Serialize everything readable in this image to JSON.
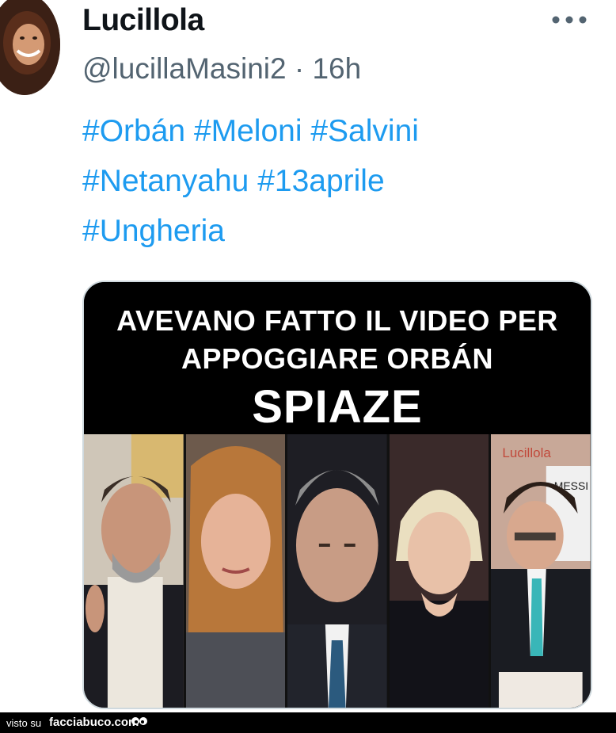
{
  "tweet": {
    "display_name": "Lucillola",
    "handle": "@lucillaMasini2",
    "separator": "·",
    "time": "16h",
    "hashtags_line1": [
      "#Orbán",
      "#Meloni",
      "#Salvini"
    ],
    "hashtags_line2": [
      "#Netanyahu",
      "#13aprile"
    ],
    "hashtags_line3": [
      "#Ungheria"
    ],
    "more_icon": "more-horizontal-icon"
  },
  "media": {
    "caption_line1": "AVEVANO FATTO IL VIDEO PER",
    "caption_line2": "APPOGGIARE ORBÁN",
    "caption_line3": "SPIAZE",
    "watermark": "Lucillola",
    "jersey_text": "MESSI"
  },
  "footer": {
    "visto_su": "visto su",
    "site": "facciabuco.com"
  },
  "colors": {
    "hashtag": "#1d9bf0",
    "muted": "#536471",
    "name": "#0f1419"
  }
}
